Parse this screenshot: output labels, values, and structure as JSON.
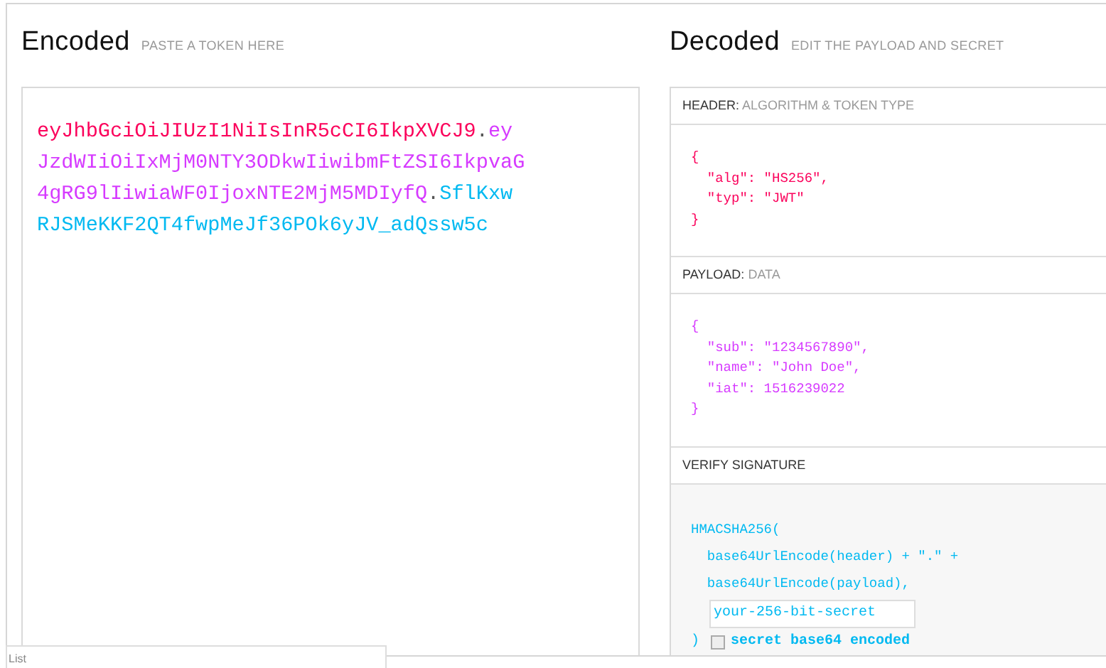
{
  "encoded": {
    "title": "Encoded",
    "subtitle": "PASTE A TOKEN HERE",
    "token": [
      {
        "kind": "header",
        "text": "eyJhbGciOiJIUzI1NiIsInR5cCI6IkpXVCJ9"
      },
      {
        "kind": "dot",
        "text": "."
      },
      {
        "kind": "payload",
        "text": "eyJzdWIiOiIxMjM0NTY3ODkwIiwibmFtZSI6IkpvaG4gRG9lIiwiaWF0IjoxNTE2MjM5MDIyfQ"
      },
      {
        "kind": "dot",
        "text": "."
      },
      {
        "kind": "signature",
        "text": "SflKxwRJSMeKKF2QT4fwpMeJf36POk6yJV_adQssw5c"
      }
    ]
  },
  "decoded": {
    "title": "Decoded",
    "subtitle": "EDIT THE PAYLOAD AND SECRET",
    "sections": [
      {
        "kind": "header",
        "label": "HEADER:",
        "sublabel": "ALGORITHM & TOKEN TYPE",
        "lines": [
          "{",
          "  \"alg\": \"HS256\",",
          "  \"typ\": \"JWT\"",
          "}"
        ]
      },
      {
        "kind": "payload",
        "label": "PAYLOAD:",
        "sublabel": "DATA",
        "lines": [
          "{",
          "  \"sub\": \"1234567890\",",
          "  \"name\": \"John Doe\",",
          "  \"iat\": 1516239022",
          "}"
        ]
      },
      {
        "kind": "verify",
        "label": "VERIFY SIGNATURE",
        "lines": [
          "HMACSHA256(",
          "  base64UrlEncode(header) + \".\" +",
          "  base64UrlEncode(payload),"
        ],
        "secret": {
          "placeholder": "your-256-bit-secret"
        },
        "close": ")",
        "checkbox": {
          "label": "secret base64 encoded",
          "checked": false
        }
      }
    ]
  },
  "tooltip": "List"
}
